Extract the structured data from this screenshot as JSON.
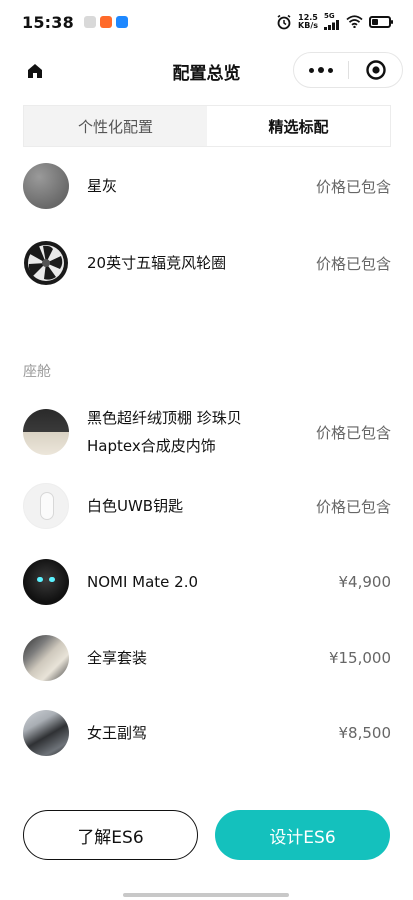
{
  "status_bar": {
    "time": "15:38",
    "network_speed_top": "12.5",
    "network_speed_bottom": "KB/s",
    "network_type": "5G",
    "battery_level": 0.35
  },
  "navbar": {
    "title": "配置总览",
    "home_icon": "home-icon",
    "more_icon": "more-dots-icon",
    "close_icon": "target-close-icon"
  },
  "tabs": [
    {
      "label": "个性化配置",
      "active": false
    },
    {
      "label": "精选标配",
      "active": true
    }
  ],
  "exterior_items": [
    {
      "name": "星灰",
      "price": "价格已包含"
    },
    {
      "name": "20英寸五辐竞风轮圈",
      "price": "价格已包含"
    }
  ],
  "cabin_section": {
    "label": "座舱",
    "items": [
      {
        "name_line1": "黑色超纤绒顶棚 珍珠贝",
        "name_line2": "Haptex合成皮内饰",
        "price": "价格已包含"
      },
      {
        "name": "白色UWB钥匙",
        "price": "价格已包含"
      },
      {
        "name": "NOMI Mate 2.0",
        "price": "¥4,900"
      },
      {
        "name": "全享套装",
        "price": "¥15,000"
      },
      {
        "name": "女王副驾",
        "price": "¥8,500"
      }
    ]
  },
  "buttons": {
    "learn": "了解ES6",
    "design": "设计ES6"
  },
  "colors": {
    "accent": "#14c1bd"
  }
}
